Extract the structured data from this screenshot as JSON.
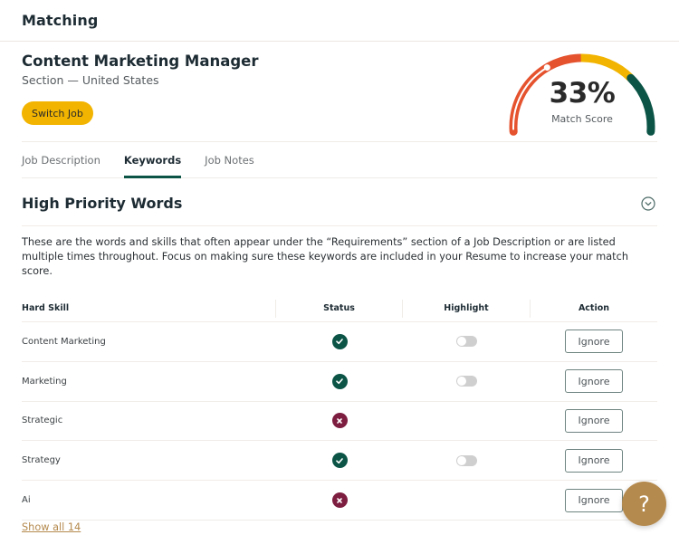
{
  "header": {
    "title": "Matching"
  },
  "job": {
    "title": "Content Marketing Manager",
    "subtitle": "Section — United States",
    "switch_label": "Switch Job"
  },
  "gauge": {
    "value_text": "33%",
    "value_fraction": 0.33,
    "label": "Match Score",
    "colors": {
      "low": "#e5522e",
      "mid": "#f2b400",
      "high": "#0b5446",
      "progress": "#ffffff"
    }
  },
  "tabs": [
    {
      "label": "Job Description",
      "active": false
    },
    {
      "label": "Keywords",
      "active": true
    },
    {
      "label": "Job Notes",
      "active": false
    }
  ],
  "section": {
    "title": "High Priority Words",
    "collapse_icon": "chevron-down-circle-icon",
    "description": "These are the words and skills that often appear under the “Requirements” section of a Job Description or are listed multiple times throughout. Focus on making sure these keywords are included in your Resume to increase your match score."
  },
  "table": {
    "headers": {
      "skill": "Hard Skill",
      "status": "Status",
      "highlight": "Highlight",
      "action": "Action"
    },
    "rows": [
      {
        "skill": "Content Marketing",
        "status": "matched",
        "highlight_visible": true,
        "highlight_on": false,
        "action": "Ignore"
      },
      {
        "skill": "Marketing",
        "status": "matched",
        "highlight_visible": true,
        "highlight_on": false,
        "action": "Ignore"
      },
      {
        "skill": "Strategic",
        "status": "missing",
        "highlight_visible": false,
        "highlight_on": false,
        "action": "Ignore"
      },
      {
        "skill": "Strategy",
        "status": "matched",
        "highlight_visible": true,
        "highlight_on": false,
        "action": "Ignore"
      },
      {
        "skill": "Ai",
        "status": "missing",
        "highlight_visible": false,
        "highlight_on": false,
        "action": "Ignore"
      }
    ],
    "status_colors": {
      "matched": "#0b5446",
      "missing": "#7d1d3f"
    }
  },
  "show_all": "Show all 14",
  "help": {
    "label": "?"
  }
}
